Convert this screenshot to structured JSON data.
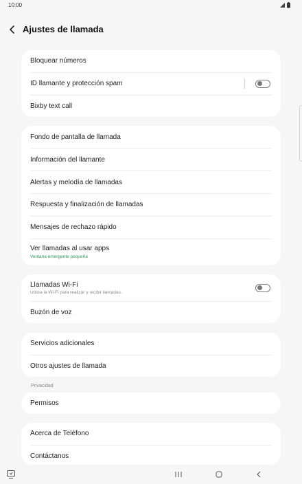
{
  "status": {
    "time": "10:00",
    "icons": [
      "signal-icon",
      "battery-icon"
    ]
  },
  "header": {
    "title": "Ajustes de llamada",
    "back_icon": "chevron-left-icon"
  },
  "cards": [
    {
      "items": [
        {
          "label": "Bloquear números"
        },
        {
          "label": "ID llamante y protección spam",
          "toggle": false
        },
        {
          "label": "Bixby text call"
        }
      ]
    },
    {
      "items": [
        {
          "label": "Fondo de pantalla de llamada"
        },
        {
          "label": "Información del llamante"
        },
        {
          "label": "Alertas y melodía de llamadas"
        },
        {
          "label": "Respuesta y finalización de llamadas"
        },
        {
          "label": "Mensajes de rechazo rápido"
        },
        {
          "label": "Ver llamadas al usar apps",
          "sublabel": "Ventana emergente pequeña"
        }
      ]
    },
    {
      "items": [
        {
          "label": "Llamadas Wi-Fi",
          "sublabel": "Utiliza la Wi-Fi para realizar y recibir llamadas.",
          "toggle": false
        },
        {
          "label": "Buzón de voz"
        }
      ]
    },
    {
      "items": [
        {
          "label": "Servicios adicionales"
        },
        {
          "label": "Otros ajustes de llamada"
        }
      ]
    },
    {
      "section_label": "Privacidad",
      "items": [
        {
          "label": "Permisos"
        }
      ]
    },
    {
      "items": [
        {
          "label": "Acerca de Teléfono"
        },
        {
          "label": "Contáctanos"
        }
      ]
    }
  ],
  "navbar": {
    "icons": [
      "screenshot-keyboard-icon",
      "recent-apps-icon",
      "home-icon",
      "back-icon"
    ]
  },
  "colors": {
    "background": "#f6f6f6",
    "card": "#ffffff",
    "accent_green": "#2b9a5a"
  }
}
